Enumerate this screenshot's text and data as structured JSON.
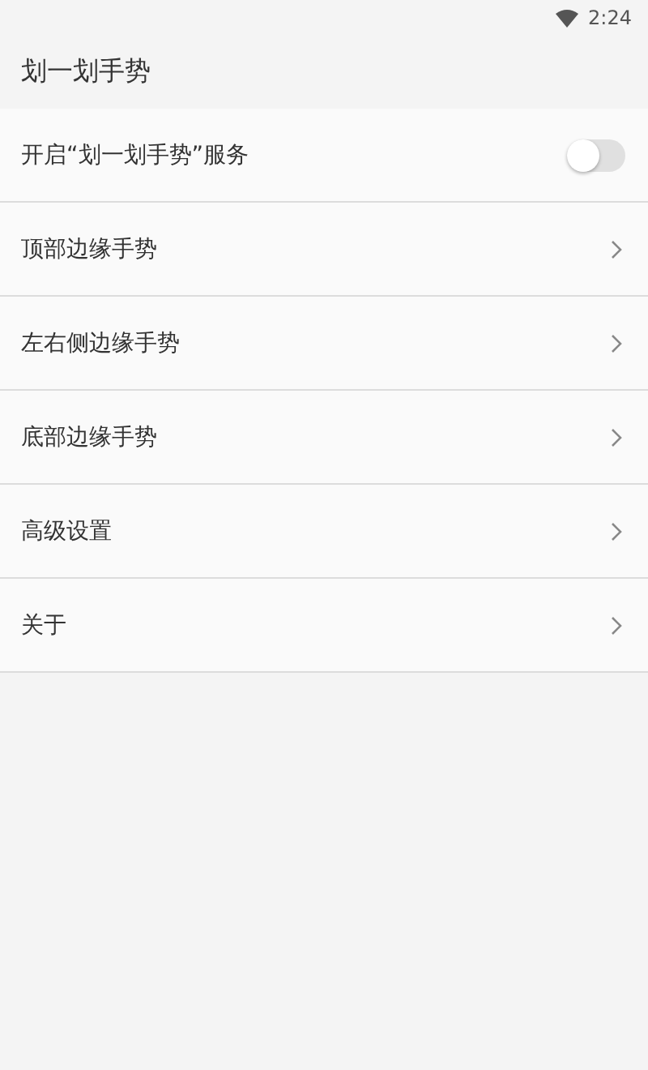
{
  "status_bar": {
    "time": "2:24"
  },
  "app_bar": {
    "title": "划一划手势"
  },
  "items": [
    {
      "kind": "switch",
      "label": "开启“划一划手势”服务",
      "on": false
    },
    {
      "kind": "link",
      "label": "顶部边缘手势"
    },
    {
      "kind": "link",
      "label": "左右侧边缘手势"
    },
    {
      "kind": "link",
      "label": "底部边缘手势"
    },
    {
      "kind": "link",
      "label": "高级设置"
    },
    {
      "kind": "link",
      "label": "关于"
    }
  ]
}
